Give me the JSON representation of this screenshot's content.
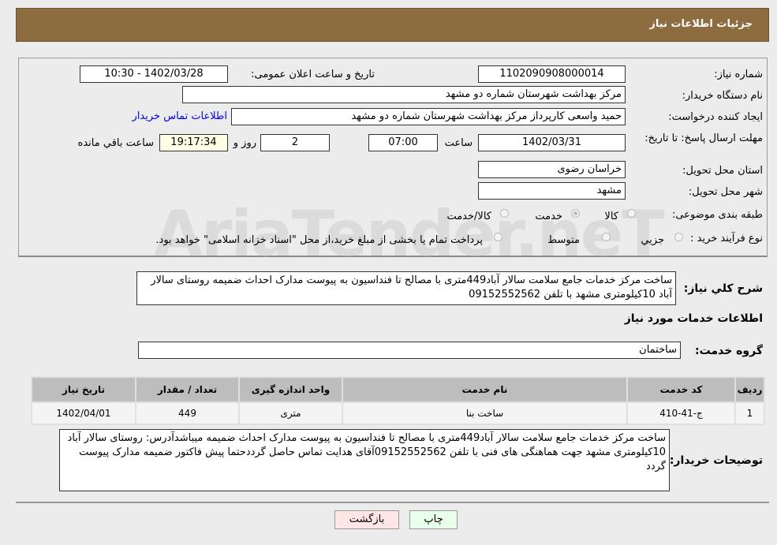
{
  "header": {
    "title": "جزئیات اطلاعات نیاز"
  },
  "watermark": "AriaTender.neT",
  "form": {
    "need_number_label": "شماره نیاز:",
    "need_number": "1102090908000014",
    "announce_label": "تاریخ و ساعت اعلان عمومی:",
    "announce_value": "1402/03/28 - 10:30",
    "buyer_label": "نام دستگاه خریدار:",
    "buyer": "مرکز بهداشت شهرستان شماره دو مشهد",
    "creator_label": "ایجاد کننده درخواست:",
    "creator": "حمید واسعی کارپرداز مرکز بهداشت شهرستان شماره دو مشهد",
    "contact_link": "اطلاعات تماس خریدار",
    "deadline_label": "مهلت ارسال پاسخ: تا تاریخ:",
    "deadline_date": "1402/03/31",
    "time_label": "ساعت",
    "deadline_time": "07:00",
    "days": "2",
    "days_label": "روز و",
    "remaining": "19:17:34",
    "remaining_label": "ساعت باقي مانده",
    "province_label": "استان محل تحویل:",
    "province": "خراسان رضوی",
    "city_label": "شهر محل تحویل:",
    "city": "مشهد",
    "category_label": "طبقه بندی موضوعی:",
    "category_options": [
      {
        "label": "کالا",
        "selected": false
      },
      {
        "label": "خدمت",
        "selected": true
      },
      {
        "label": "کالا/خدمت",
        "selected": false
      }
    ],
    "process_label": "نوع فرآیند خرید :",
    "process_options": [
      {
        "label": "جزیي",
        "selected": false
      },
      {
        "label": "متوسط",
        "selected": false
      }
    ],
    "process_note": "پرداخت تمام یا بخشی از مبلغ خرید،از محل \"اسناد خزانه اسلامی\" خواهد بود."
  },
  "description": {
    "label": "شرح کلي نياز:",
    "text": "ساخت مرکز خدمات جامع سلامت سالار آباد449متری با مصالح  تا فنداسیون به پیوست مدارک احداث ضمیمه روستای سالار آباد 10کیلومتری مشهد با تلفن 09152552562"
  },
  "services": {
    "title": "اطلاعات خدمات مورد نیاز",
    "group_label": "گروه خدمت:",
    "group": "ساختمان",
    "columns": [
      "ردیف",
      "کد خدمت",
      "نام خدمت",
      "واحد اندازه گیری",
      "تعداد / مقدار",
      "تاریخ نیاز"
    ],
    "rows": [
      [
        "1",
        "ج-41-410",
        "ساخت بنا",
        "متری",
        "449",
        "1402/04/01"
      ]
    ]
  },
  "buyer_notes": {
    "label": "توضیحات خریدار:",
    "text": "ساخت مرکز خدمات جامع سلامت سالار آباد449متری با مصالح  تا فنداسیون به پیوست مدارک احداث ضمیمه میباشدآدرس: روستای سالار آباد 10کیلومتری مشهد جهت هماهنگی های فنی با تلفن 09152552562آقای هدایت تماس حاصل گرددحتما پیش فاکتور ضمیمه مدارک پیوست گردد"
  },
  "buttons": {
    "print": "چاپ",
    "back": "بازگشت"
  },
  "colors": {
    "header": "#8d6c3f",
    "link": "#0000ee",
    "print_bg": "#eaffea",
    "back_bg": "#ffe6e6"
  }
}
